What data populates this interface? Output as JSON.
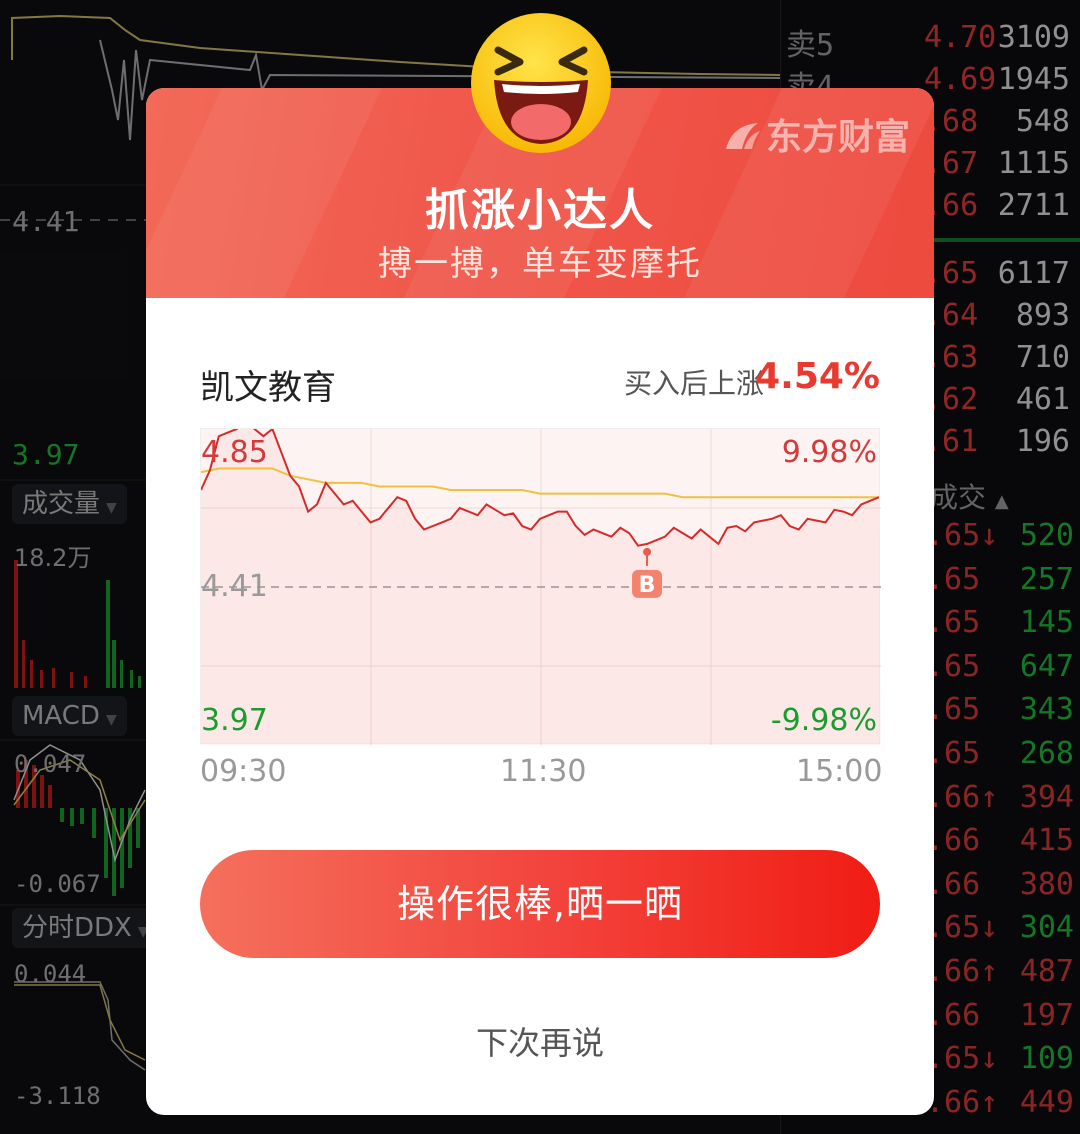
{
  "background": {
    "chart_labels": {
      "ref_price": "4.41",
      "low_price": "3.97",
      "volume_tab": "成交量",
      "volume_value": "18.2万",
      "macd_tab": "MACD",
      "macd_high": "0.047",
      "macd_low": "-0.067",
      "ddx_tab": "分时DDX",
      "ddx_high": "0.044",
      "ddx_low": "-3.118"
    },
    "order_book": [
      {
        "label": "卖5",
        "price": "4.70",
        "volume": "3109"
      },
      {
        "label": "卖4",
        "price": "4.69",
        "volume": "1945"
      },
      {
        "label": "",
        "price": ".68",
        "volume": "548"
      },
      {
        "label": "",
        "price": ".67",
        "volume": "1115"
      },
      {
        "label": "",
        "price": ".66",
        "volume": "2711"
      },
      {
        "label": "",
        "price": ".65",
        "volume": "6117"
      },
      {
        "label": "",
        "price": ".64",
        "volume": "893"
      },
      {
        "label": "",
        "price": ".63",
        "volume": "710"
      },
      {
        "label": "",
        "price": ".62",
        "volume": "461"
      },
      {
        "label": "",
        "price": ".61",
        "volume": "196"
      }
    ],
    "trades_header": "成交",
    "trades": [
      {
        "price": ".65↓",
        "volume": "520",
        "color": "green"
      },
      {
        "price": ".65",
        "volume": "257",
        "color": "green"
      },
      {
        "price": ".65",
        "volume": "145",
        "color": "green"
      },
      {
        "price": ".65",
        "volume": "647",
        "color": "green"
      },
      {
        "price": ".65",
        "volume": "343",
        "color": "green"
      },
      {
        "price": ".65",
        "volume": "268",
        "color": "green"
      },
      {
        "price": ".66↑",
        "volume": "394",
        "color": "red"
      },
      {
        "price": ".66",
        "volume": "415",
        "color": "red"
      },
      {
        "price": ".66",
        "volume": "380",
        "color": "red"
      },
      {
        "price": ".65↓",
        "volume": "304",
        "color": "green"
      },
      {
        "price": ".66↑",
        "volume": "487",
        "color": "red"
      },
      {
        "price": ".66",
        "volume": "197",
        "color": "red"
      },
      {
        "price": ".65↓",
        "volume": "109",
        "color": "green"
      },
      {
        "price": ".66↑",
        "volume": "449",
        "color": "red"
      }
    ]
  },
  "modal": {
    "logo": "东方财富",
    "title": "抓涨小达人",
    "subtitle": "搏一搏，单车变摩托",
    "stock_name": "凯文教育",
    "gain_label": "买入后上涨",
    "gain_value": "4.54%",
    "chart": {
      "max_price": "4.85",
      "ref_price": "4.41",
      "min_price": "3.97",
      "max_pct": "9.98%",
      "min_pct": "-9.98%",
      "buy_marker": "B",
      "times": [
        "09:30",
        "11:30",
        "15:00"
      ]
    },
    "share_button": "操作很棒,晒一晒",
    "later_button": "下次再说",
    "colors": {
      "accent": "#e83a2e",
      "header": "#f0564a",
      "rise": "#d43a3a",
      "fall": "#1a9c2e"
    }
  },
  "chart_data": {
    "type": "line",
    "ylim": [
      3.97,
      4.85
    ],
    "reference": 4.41,
    "series": [
      {
        "values": [
          4.68,
          4.83,
          4.85,
          4.85,
          4.85,
          4.72,
          4.62,
          4.7,
          4.64,
          4.62,
          4.6,
          4.66,
          4.6,
          4.58,
          4.6,
          4.62,
          4.64,
          4.61,
          4.58,
          4.6,
          4.62,
          4.58,
          4.57,
          4.55,
          4.56,
          4.53,
          4.55,
          4.56,
          4.57,
          4.53,
          4.58,
          4.59,
          4.6,
          4.58,
          4.6,
          4.59,
          4.62,
          4.64,
          4.66
        ]
      },
      {
        "values": [
          4.73,
          4.74,
          4.74,
          4.74,
          4.74,
          4.72,
          4.71,
          4.7,
          4.7,
          4.7,
          4.69,
          4.69,
          4.69,
          4.69,
          4.68,
          4.68,
          4.68,
          4.68,
          4.68,
          4.67,
          4.67,
          4.67,
          4.67,
          4.67,
          4.67,
          4.67,
          4.67,
          4.66,
          4.66,
          4.66,
          4.66,
          4.66,
          4.66,
          4.66,
          4.66,
          4.66,
          4.66,
          4.66,
          4.66
        ]
      }
    ]
  }
}
